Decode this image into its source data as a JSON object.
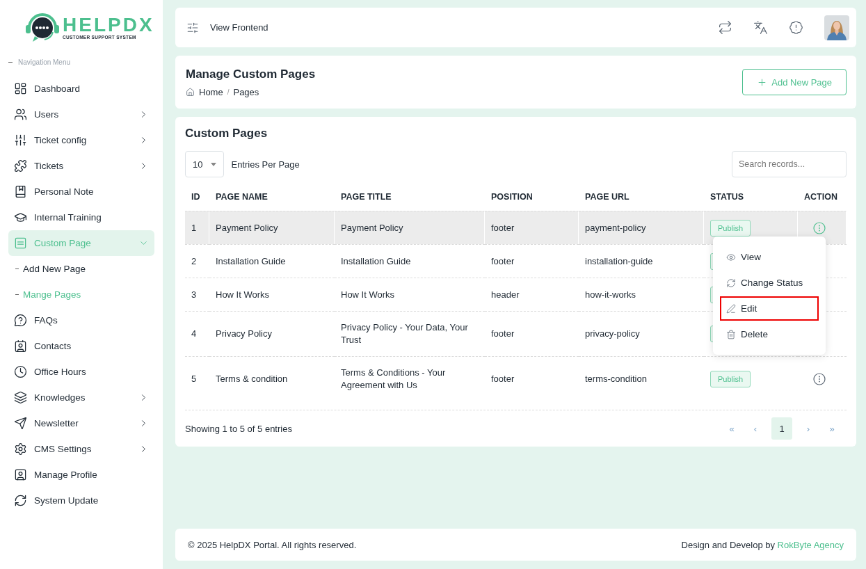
{
  "logo": {
    "name": "HELPDX",
    "tagline": "CUSTOMER SUPPORT SYSTEM"
  },
  "sidebar": {
    "heading": "Navigation Menu",
    "items": [
      {
        "label": "Dashboard",
        "selected": false
      },
      {
        "label": "Users",
        "selected": false,
        "expanded": false
      },
      {
        "label": "Ticket config",
        "selected": false,
        "expanded": false
      },
      {
        "label": "Tickets",
        "selected": false,
        "expanded": false
      },
      {
        "label": "Personal Note",
        "selected": false
      },
      {
        "label": "Internal Training",
        "selected": false
      },
      {
        "label": "Custom Page",
        "selected": true,
        "expanded": true,
        "children": [
          {
            "label": "Add New Page",
            "selected": false
          },
          {
            "label": "Mange Pages",
            "selected": true
          }
        ]
      },
      {
        "label": "FAQs",
        "selected": false
      },
      {
        "label": "Contacts",
        "selected": false
      },
      {
        "label": "Office Hours",
        "selected": false
      },
      {
        "label": "Knowledges",
        "selected": false,
        "expanded": false
      },
      {
        "label": "Newsletter",
        "selected": false,
        "expanded": false
      },
      {
        "label": "CMS Settings",
        "selected": false,
        "expanded": false
      },
      {
        "label": "Manage Profile",
        "selected": false
      },
      {
        "label": "System Update",
        "selected": false
      }
    ]
  },
  "topbar": {
    "link": "View Frontend"
  },
  "header": {
    "title": "Manage Custom Pages",
    "breadcrumb": [
      "Home",
      "/",
      "Pages"
    ],
    "add_button": "Add New Page"
  },
  "card": {
    "title": "Custom Pages",
    "entries": {
      "value": "10",
      "label": "Entries Per Page"
    },
    "search": {
      "placeholder": "Search records..."
    },
    "table": {
      "columns": [
        "ID",
        "PAGE NAME",
        "PAGE TITLE",
        "POSITION",
        "PAGE URL",
        "STATUS",
        "ACTION"
      ],
      "rows": [
        {
          "id": "1",
          "name": "Payment Policy",
          "title": "Payment Policy",
          "position": "footer",
          "url": "payment-policy",
          "status": "Publish",
          "selected": true
        },
        {
          "id": "2",
          "name": "Installation Guide",
          "title": "Installation Guide",
          "position": "footer",
          "url": "installation-guide",
          "selected": false
        },
        {
          "id": "3",
          "name": "How It Works",
          "title": "How It Works",
          "position": "header",
          "url": "how-it-works",
          "selected": false
        },
        {
          "id": "4",
          "name": "Privacy Policy",
          "title": "Privacy Policy - Your Data, Your Trust",
          "position": "footer",
          "url": "privacy-policy",
          "selected": false
        },
        {
          "id": "5",
          "name": "Terms & condition",
          "title": "Terms & Conditions - Your Agreement with Us",
          "position": "footer",
          "url": "terms-condition",
          "status": "Publish",
          "selected": false
        }
      ]
    },
    "action_menu": [
      {
        "label": "View",
        "highlighted": false
      },
      {
        "label": "Change Status",
        "highlighted": false
      },
      {
        "label": "Edit",
        "highlighted": true
      },
      {
        "label": "Delete",
        "highlighted": false
      }
    ],
    "summary": "Showing 1 to 5 of 5 entries",
    "pagination": [
      {
        "label": "«",
        "selected": false
      },
      {
        "label": "‹",
        "selected": false
      },
      {
        "label": "1",
        "selected": true
      },
      {
        "label": "›",
        "selected": false
      },
      {
        "label": "»",
        "selected": false
      }
    ]
  },
  "footer": {
    "copyright": "© 2025 HelpDX Portal. All rights reserved.",
    "credit": "Design and Develop by",
    "credit_link": "RokByte Agency"
  }
}
